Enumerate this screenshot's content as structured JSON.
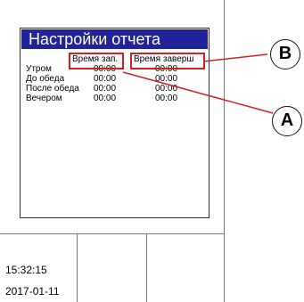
{
  "screen": {
    "title": "Настройки отчета",
    "header": {
      "start": "Время зап.",
      "end": "Время заверш"
    },
    "rows": [
      {
        "label": "Утром",
        "start": "00:00",
        "end": "00:00"
      },
      {
        "label": "До обеда",
        "start": "00:00",
        "end": "00:00"
      },
      {
        "label": "После обеда",
        "start": "00:00",
        "end": "00:00"
      },
      {
        "label": "Вечером",
        "start": "00:00",
        "end": "00:00"
      }
    ]
  },
  "status": {
    "time": "15:32:15",
    "date": "2017-01-11"
  },
  "callouts": {
    "a": "A",
    "b": "B"
  },
  "colors": {
    "title_bg": "#22229a",
    "highlight": "#d42020"
  }
}
